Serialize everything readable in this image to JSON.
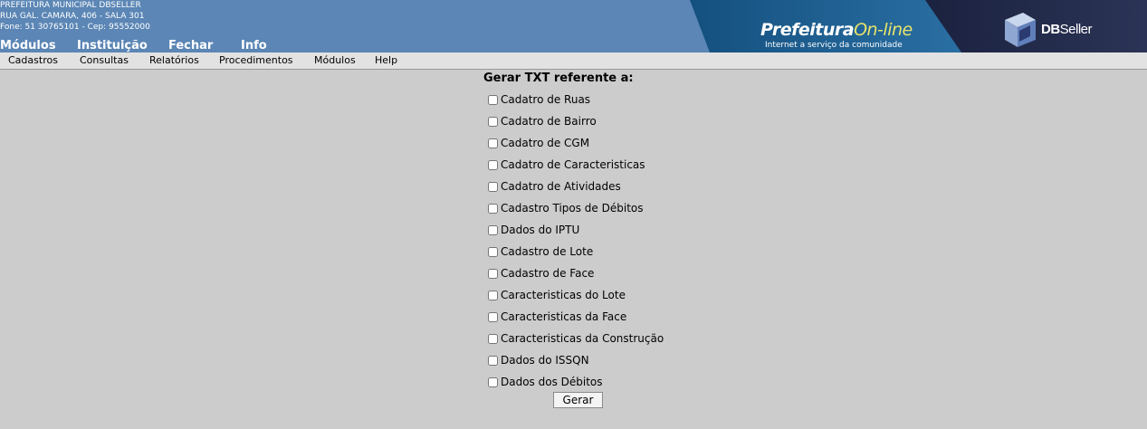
{
  "header": {
    "org_lines": [
      "PREFEITURA MUNICIPAL DBSELLER",
      "RUA GAL. CAMARA, 406 - SALA 301",
      "Fone: 51 30765101  -  Cep: 95552000"
    ],
    "top_menu": [
      "Módulos",
      "Instituição",
      "Fechar",
      "Info"
    ],
    "brand": {
      "prefeitura": "Prefeitura",
      "online": "On-line",
      "tagline": "Internet a serviço da comunidade",
      "dbseller_bold": "DB",
      "dbseller_rest": "Seller"
    },
    "colors": {
      "header_bg": "#5b86b5",
      "banner_dark": "#232a4a",
      "banner_blue": "#1f5d8f"
    }
  },
  "menubar": [
    "Cadastros",
    "Consultas",
    "Relatórios",
    "Procedimentos",
    "Módulos",
    "Help"
  ],
  "form": {
    "title": "Gerar TXT referente a:",
    "options": [
      {
        "label": "Cadatro de Ruas",
        "checked": false
      },
      {
        "label": "Cadatro de Bairro",
        "checked": false
      },
      {
        "label": "Cadatro de CGM",
        "checked": false
      },
      {
        "label": "Cadatro de Caracteristicas",
        "checked": false
      },
      {
        "label": "Cadatro de Atividades",
        "checked": false
      },
      {
        "label": "Cadastro Tipos de Débitos",
        "checked": false
      },
      {
        "label": "Dados do IPTU",
        "checked": false
      },
      {
        "label": "Cadastro de Lote",
        "checked": false
      },
      {
        "label": "Cadastro de Face",
        "checked": false
      },
      {
        "label": "Caracteristicas do Lote",
        "checked": false
      },
      {
        "label": "Caracteristicas da Face",
        "checked": false
      },
      {
        "label": "Caracteristicas da Construção",
        "checked": false
      },
      {
        "label": "Dados do ISSQN",
        "checked": false
      },
      {
        "label": "Dados dos Débitos",
        "checked": false
      }
    ],
    "submit_label": "Gerar"
  }
}
